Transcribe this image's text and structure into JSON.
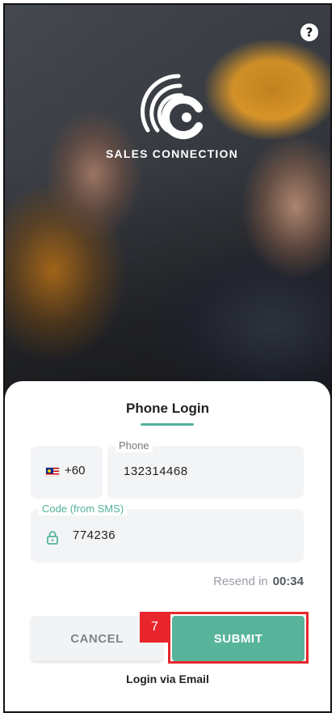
{
  "hero": {
    "brand_name": "SALES CONNECTION",
    "help_icon": "question-circle-icon",
    "logo_icon": "sales-connection-logo"
  },
  "login": {
    "title": "Phone Login",
    "country_code": "+60",
    "country_flag": "malaysia-flag-icon",
    "phone_label": "Phone",
    "phone_value": "132314468",
    "code_label": "Code (from SMS)",
    "code_icon": "lock-icon",
    "code_value": "774236",
    "resend_text": "Resend in",
    "resend_timer": "00:34",
    "cancel_label": "CANCEL",
    "submit_label": "SUBMIT",
    "step_marker": "7",
    "email_link": "Login via Email"
  },
  "colors": {
    "accent": "#57b49a",
    "highlight": "#e8262b",
    "muted_text": "#9a9ea5",
    "field_bg": "#f3f4f6"
  }
}
